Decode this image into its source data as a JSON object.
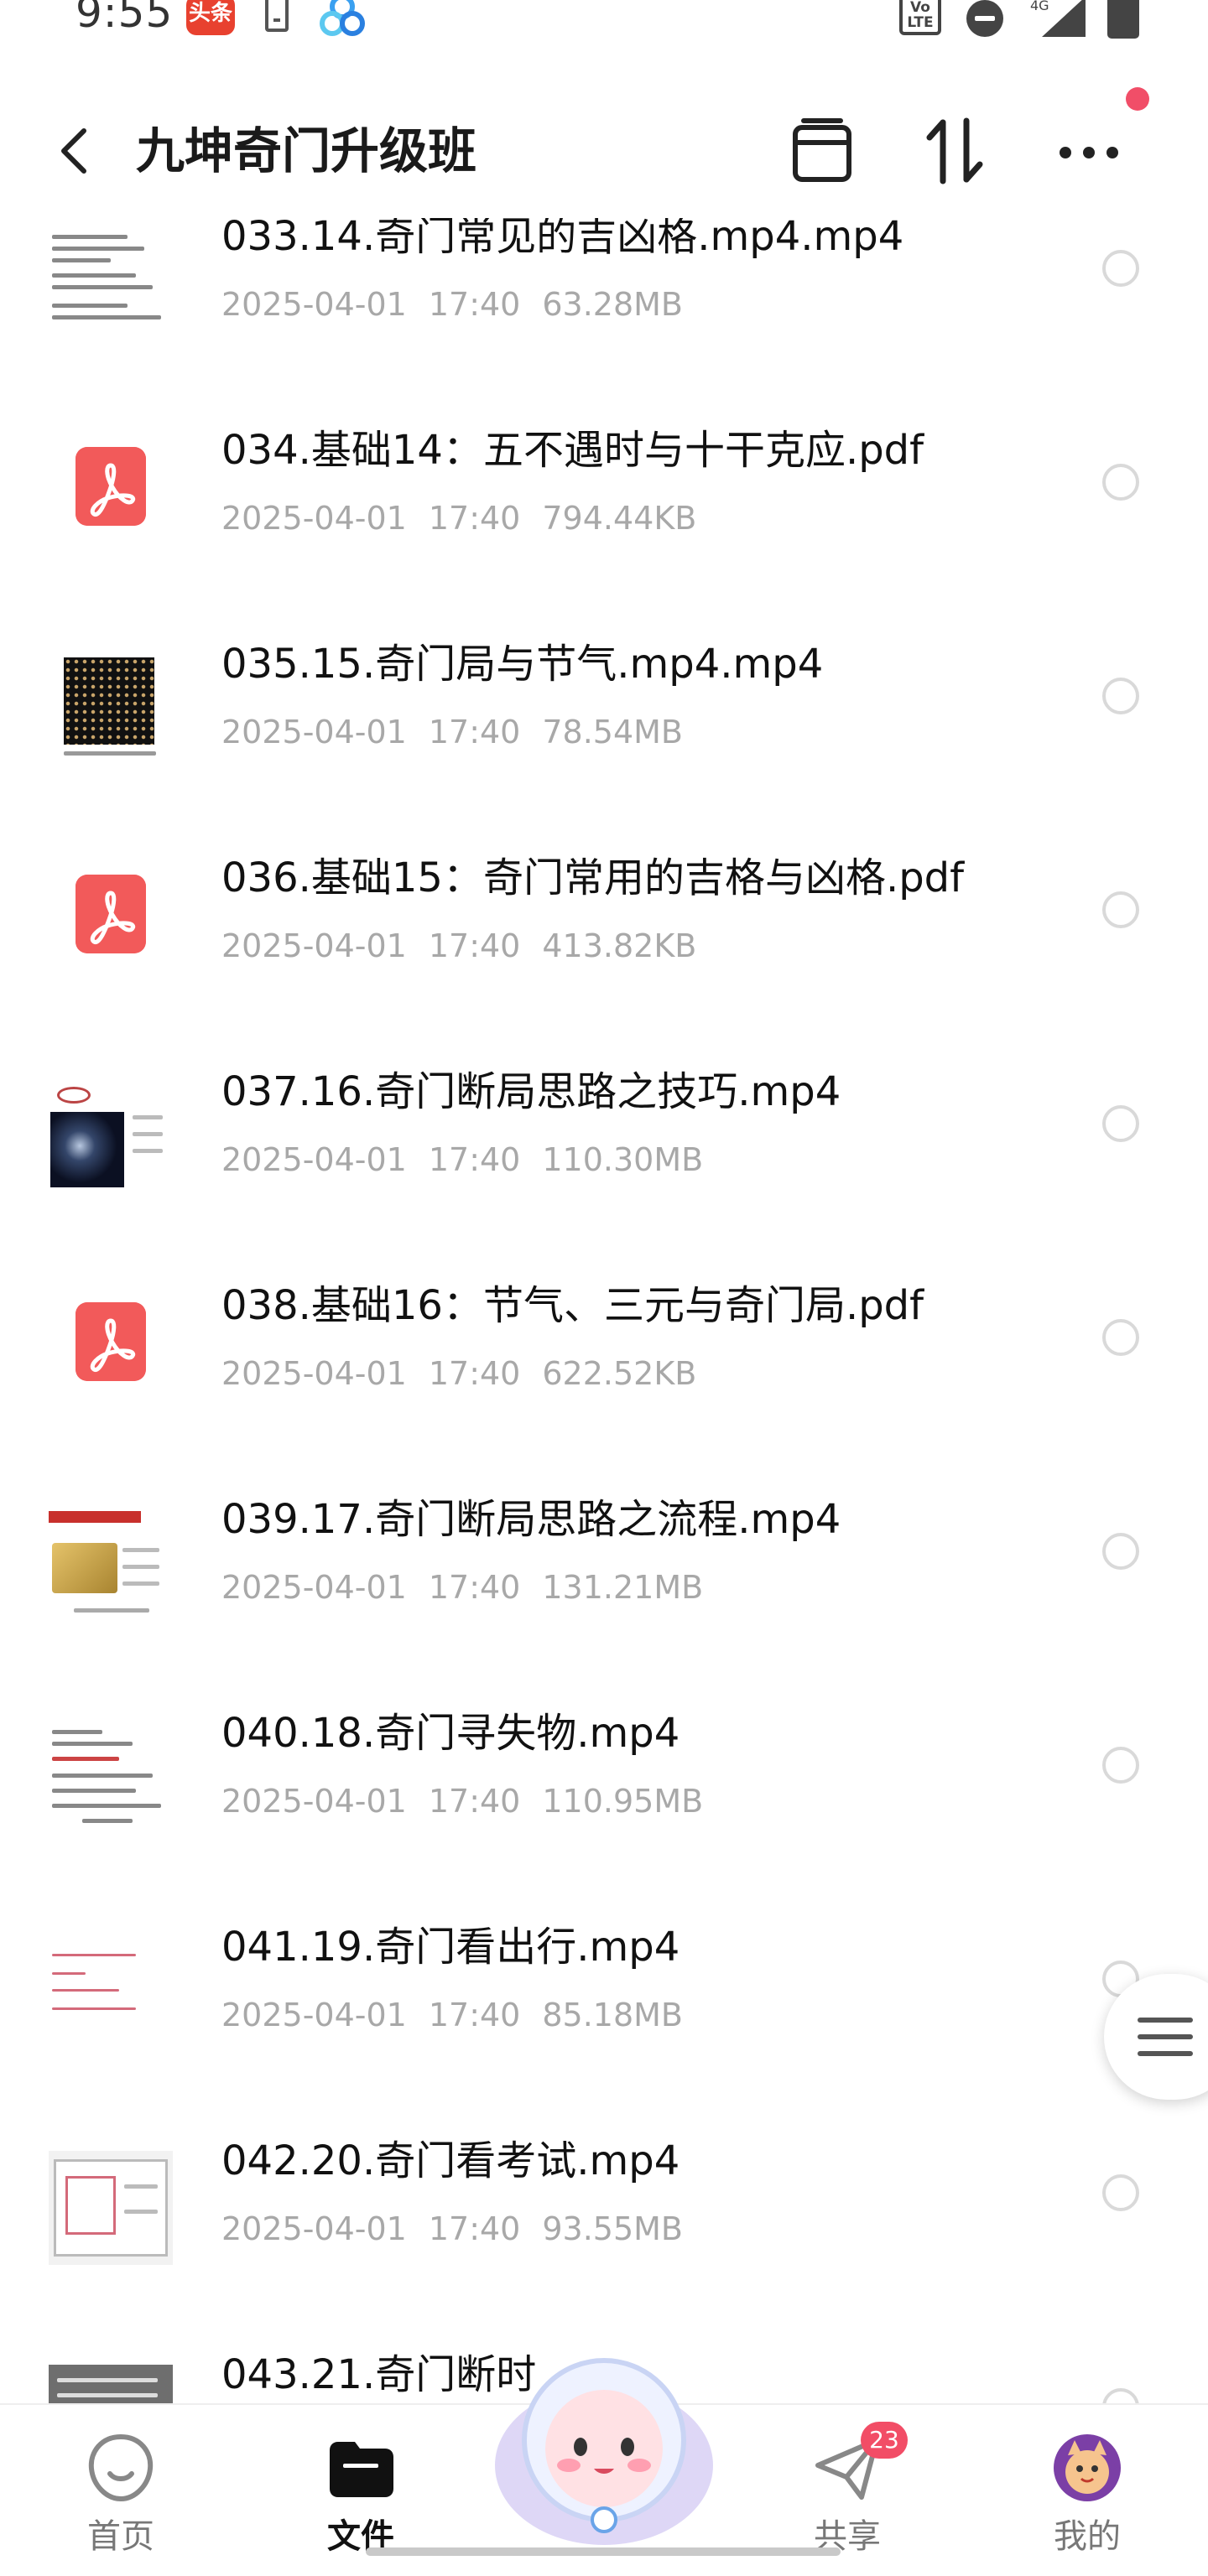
{
  "status_bar": {
    "time": "9:55",
    "toutiao_label": "头条",
    "network_label": "4G",
    "volte_label": "Vo LTE"
  },
  "header": {
    "title": "九坤奇门升级班",
    "icons": [
      "back-icon",
      "archive-icon",
      "sort-icon",
      "more-icon"
    ]
  },
  "files": [
    {
      "name": "033.14.奇门常见的吉凶格.mp4.mp4",
      "date": "2025-04-01",
      "time": "17:40",
      "size": "63.28MB",
      "type": "video",
      "thumb": "doc"
    },
    {
      "name": "034.基础14：五不遇时与十干克应.pdf",
      "date": "2025-04-01",
      "time": "17:40",
      "size": "794.44KB",
      "type": "pdf"
    },
    {
      "name": "035.15.奇门局与节气.mp4.mp4",
      "date": "2025-04-01",
      "time": "17:40",
      "size": "78.54MB",
      "type": "video",
      "thumb": "dark-grid"
    },
    {
      "name": "036.基础15：奇门常用的吉格与凶格.pdf",
      "date": "2025-04-01",
      "time": "17:40",
      "size": "413.82KB",
      "type": "pdf"
    },
    {
      "name": "037.16.奇门断局思路之技巧.mp4",
      "date": "2025-04-01",
      "time": "17:40",
      "size": "110.30MB",
      "type": "video",
      "thumb": "space"
    },
    {
      "name": "038.基础16：节气、三元与奇门局.pdf",
      "date": "2025-04-01",
      "time": "17:40",
      "size": "622.52KB",
      "type": "pdf"
    },
    {
      "name": "039.17.奇门断局思路之流程.mp4",
      "date": "2025-04-01",
      "time": "17:40",
      "size": "131.21MB",
      "type": "video",
      "thumb": "gold"
    },
    {
      "name": "040.18.奇门寻失物.mp4",
      "date": "2025-04-01",
      "time": "17:40",
      "size": "110.95MB",
      "type": "video",
      "thumb": "doc"
    },
    {
      "name": "041.19.奇门看出行.mp4",
      "date": "2025-04-01",
      "time": "17:40",
      "size": "85.18MB",
      "type": "video",
      "thumb": "handwritten"
    },
    {
      "name": "042.20.奇门看考试.mp4",
      "date": "2025-04-01",
      "time": "17:40",
      "size": "93.55MB",
      "type": "video",
      "thumb": "table"
    },
    {
      "name": "043.21.奇门断时",
      "date": "",
      "time": "",
      "size": "",
      "type": "video",
      "thumb": "gray-table"
    }
  ],
  "bottom_nav": {
    "items": [
      {
        "label": "首页",
        "icon": "home-icon",
        "active": false
      },
      {
        "label": "文件",
        "icon": "folder-icon",
        "active": true
      },
      {
        "label": "共享",
        "icon": "share-icon",
        "active": false,
        "badge": "23"
      },
      {
        "label": "我的",
        "icon": "profile-avatar-icon",
        "active": false
      }
    ]
  },
  "colors": {
    "accent_red": "#f24d66",
    "pdf_red": "#f25a5a",
    "meta_gray": "#a8a8a8"
  }
}
